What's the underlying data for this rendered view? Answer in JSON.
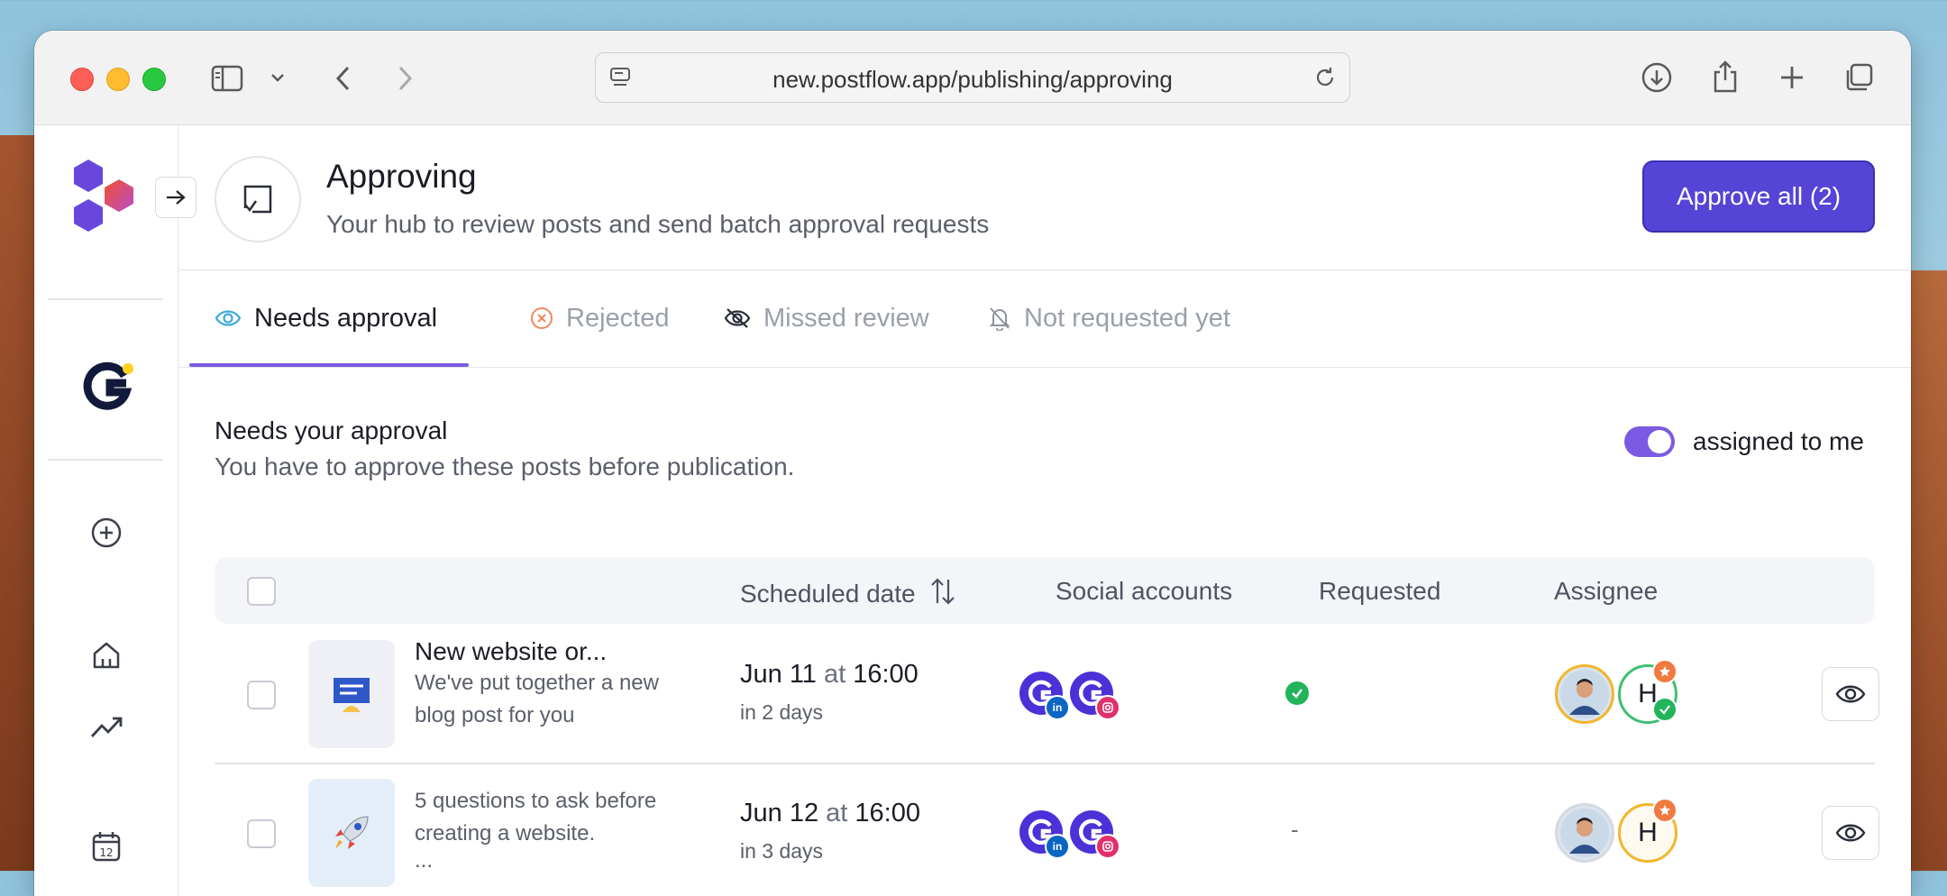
{
  "browser": {
    "url": "new.postflow.app/publishing/approving"
  },
  "header": {
    "title": "Approving",
    "subtitle": "Your hub to review posts and send batch approval requests",
    "approve_all_label": "Approve all (2)"
  },
  "tabs": [
    {
      "label": "Needs approval",
      "icon": "eye-icon",
      "active": true
    },
    {
      "label": "Rejected",
      "icon": "x-circle-icon",
      "active": false
    },
    {
      "label": "Missed review",
      "icon": "eye-off-icon",
      "active": false
    },
    {
      "label": "Not requested yet",
      "icon": "bell-off-icon",
      "active": false
    }
  ],
  "section": {
    "title": "Needs your approval",
    "subtitle": "You have to approve these posts before publication.",
    "toggle_label": "assigned to me",
    "toggle_on": true
  },
  "table": {
    "columns": [
      "Scheduled date",
      "Social accounts",
      "Requested",
      "Assignee"
    ],
    "rows": [
      {
        "title": "New website or...",
        "text_line1": "We've put together a new",
        "text_line2": "blog post for you",
        "date": "Jun 11",
        "at": "at",
        "time": "16:00",
        "relative": "in 2 days",
        "requested": "check",
        "accounts": [
          "linkedin",
          "instagram"
        ],
        "assignee_initial": "H"
      },
      {
        "title": "",
        "text_line1": "5 questions to ask before",
        "text_line2": "creating a website.",
        "text_line3": "...",
        "date": "Jun 12",
        "at": "at",
        "time": "16:00",
        "relative": "in 3 days",
        "requested": "-",
        "accounts": [
          "linkedin",
          "instagram"
        ],
        "assignee_initial": "H"
      }
    ]
  },
  "colors": {
    "accent": "#5544d6",
    "toggle": "#7a5ae2",
    "success": "#22b45a",
    "linkedin": "#0a66c2",
    "instagram": "#e1306c",
    "badge_orange": "#f07a3f"
  }
}
